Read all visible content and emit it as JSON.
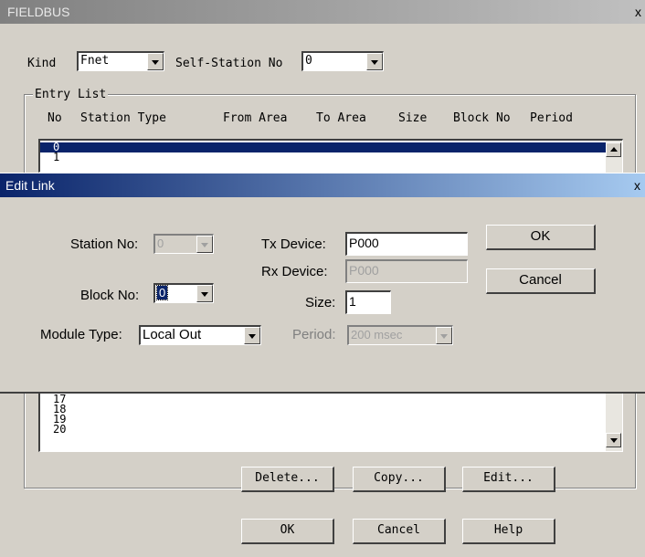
{
  "outer": {
    "title": "FIELDBUS",
    "close": "x",
    "kind_label": "Kind",
    "kind_value": "Fnet",
    "self_station_label": "Self-Station No",
    "self_station_value": "0",
    "entry_list_label": "Entry List",
    "columns": [
      "No",
      "Station Type",
      "From Area",
      "To Area",
      "Size",
      "Block No",
      "Period"
    ],
    "rows_top": [
      "0",
      "1"
    ],
    "rows_bottom": [
      "17",
      "18",
      "19",
      "20"
    ],
    "buttons": {
      "delete": "Delete...",
      "copy": "Copy...",
      "edit": "Edit..."
    },
    "footer": {
      "ok": "OK",
      "cancel": "Cancel",
      "help": "Help"
    }
  },
  "edit_link": {
    "title": "Edit Link",
    "close": "x",
    "station_no_label": "Station No:",
    "station_no_value": "0",
    "block_no_label": "Block No:",
    "block_no_value": "0",
    "module_type_label": "Module Type:",
    "module_type_value": "Local Out",
    "tx_device_label": "Tx Device:",
    "tx_device_value": "P000",
    "rx_device_label": "Rx Device:",
    "rx_device_value": "P000",
    "size_label": "Size:",
    "size_value": "1",
    "period_label": "Period:",
    "period_value": "200 msec",
    "ok": "OK",
    "cancel": "Cancel"
  }
}
